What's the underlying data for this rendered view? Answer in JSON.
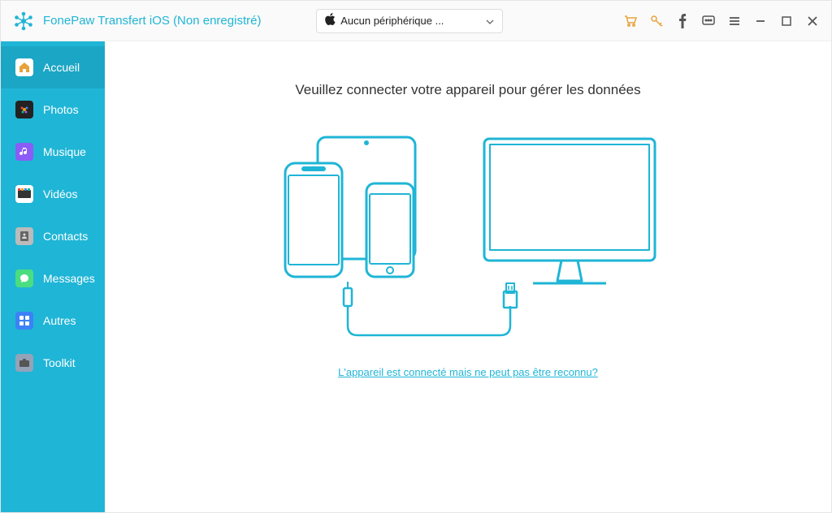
{
  "app": {
    "title": "FonePaw Transfert iOS (Non enregistré)"
  },
  "device_selector": {
    "label": "Aucun périphérique ..."
  },
  "sidebar": {
    "items": [
      {
        "label": "Accueil",
        "icon": "home-icon"
      },
      {
        "label": "Photos",
        "icon": "photos-icon"
      },
      {
        "label": "Musique",
        "icon": "music-icon"
      },
      {
        "label": "Vidéos",
        "icon": "videos-icon"
      },
      {
        "label": "Contacts",
        "icon": "contacts-icon"
      },
      {
        "label": "Messages",
        "icon": "messages-icon"
      },
      {
        "label": "Autres",
        "icon": "others-icon"
      },
      {
        "label": "Toolkit",
        "icon": "toolkit-icon"
      }
    ]
  },
  "main": {
    "instruction": "Veuillez connecter votre appareil pour gérer les données",
    "help_link": "L'appareil est connecté mais ne peut pas être reconnu?"
  },
  "colors": {
    "accent": "#1fb5d6",
    "toolbar_orange": "#e8a23a"
  }
}
